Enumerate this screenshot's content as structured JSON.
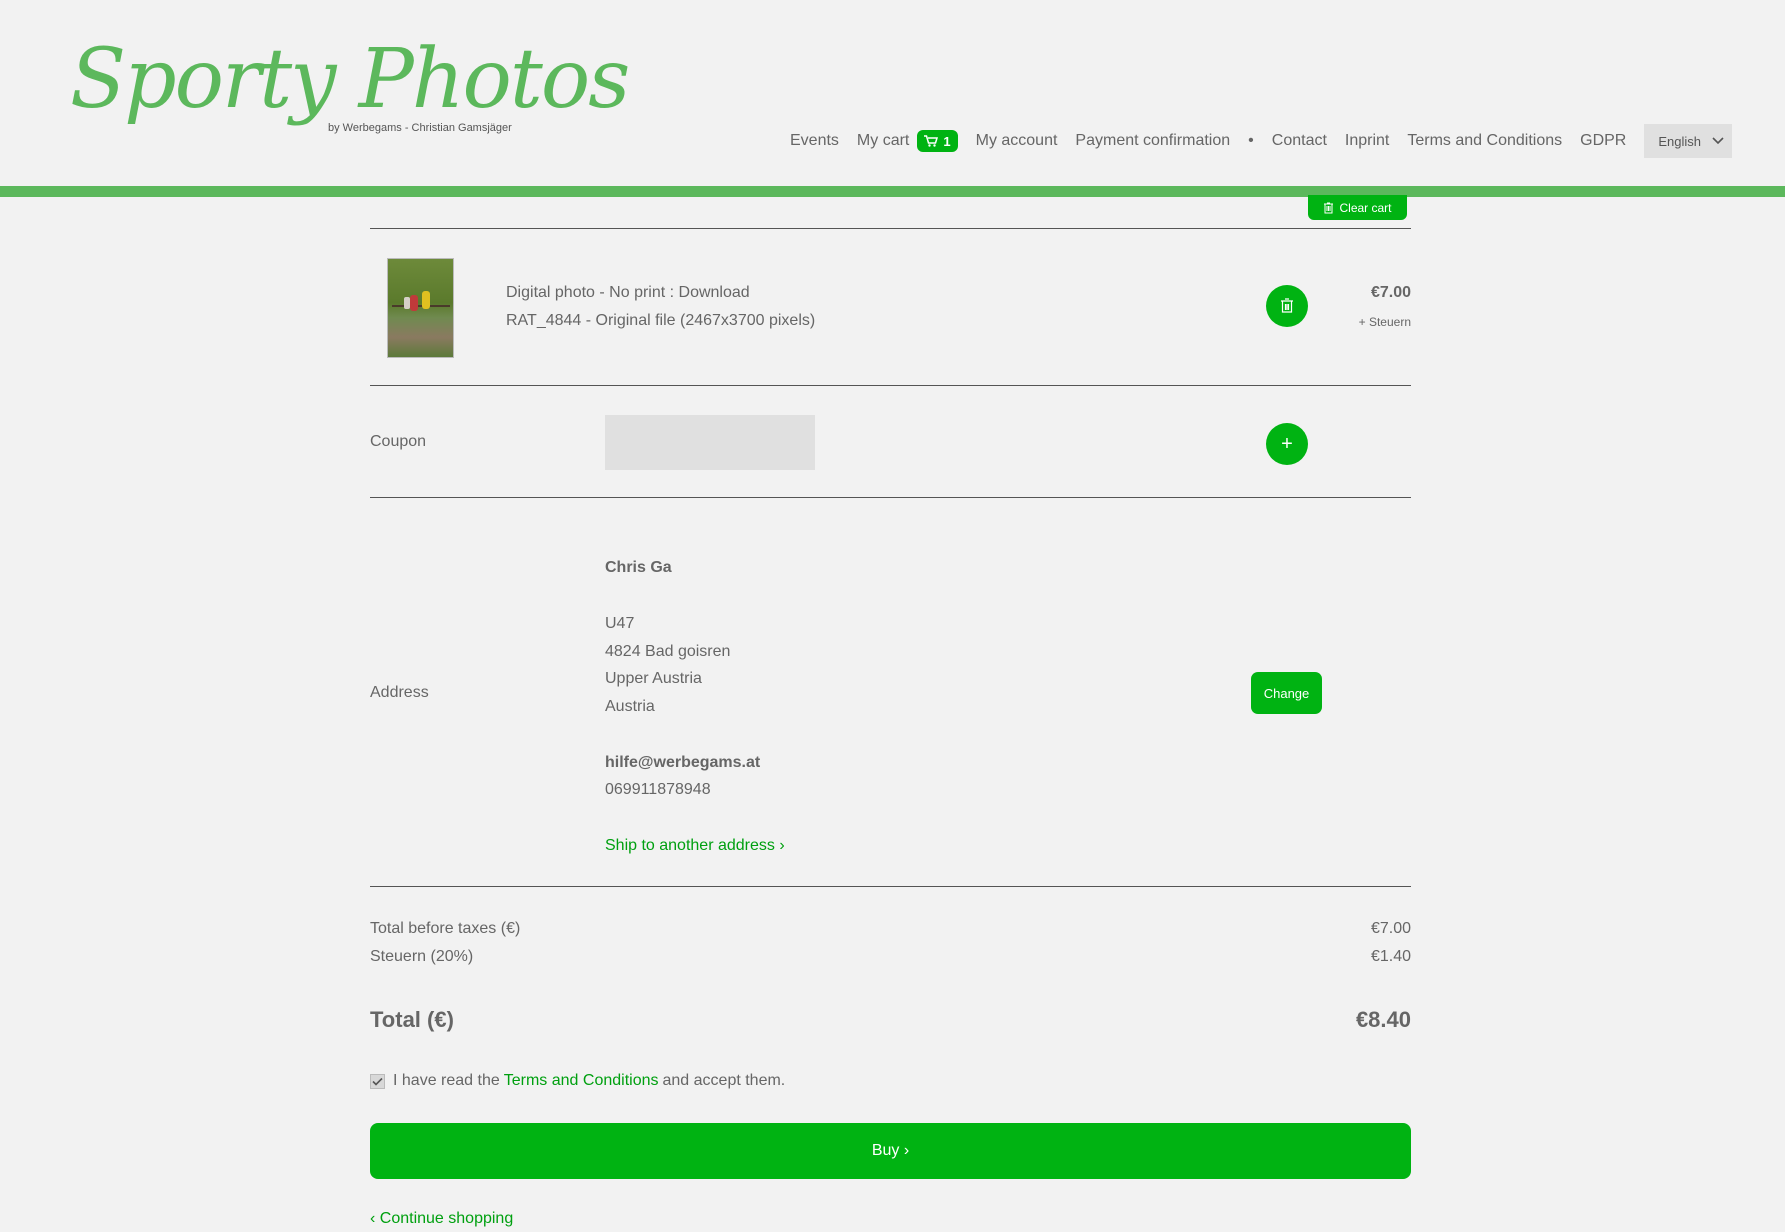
{
  "brand": {
    "logo_text": "Sporty Photos",
    "logo_sub": "by Werbegams - Christian Gamsjäger",
    "accent": "#00b312",
    "bar_color": "#5cb85c"
  },
  "nav": {
    "events": "Events",
    "my_cart": "My cart",
    "cart_count": "1",
    "my_account": "My account",
    "payment_confirmation": "Payment confirmation",
    "separator": "•",
    "contact": "Contact",
    "inprint": "Inprint",
    "terms": "Terms and Conditions",
    "gdpr": "GDPR",
    "language": "English"
  },
  "cart": {
    "clear_label": "Clear cart",
    "item": {
      "line1": "Digital photo - No print : Download",
      "line2": "RAT_4844 - Original file (2467x3700 pixels)",
      "price": "€7.00",
      "tax_note": "+ Steuern"
    },
    "coupon_label": "Coupon",
    "coupon_add": "+",
    "address_label": "Address",
    "address": {
      "name": "Chris Ga",
      "line1": "U47",
      "line2": "4824 Bad goisren",
      "line3": "Upper Austria",
      "line4": "Austria",
      "email": "hilfe@werbegams.at",
      "phone": "069911878948",
      "change": "Change",
      "ship_other": "Ship to another address  ›"
    },
    "summary": {
      "before_tax_label": "Total before taxes (€)",
      "before_tax_value": "€7.00",
      "tax_label": "Steuern (20%)",
      "tax_value": "€1.40",
      "total_label": "Total (€)",
      "total_value": "€8.40"
    },
    "terms": {
      "pre": "I have read the",
      "link": "Terms and Conditions",
      "post": "and accept them.",
      "checked": true
    },
    "buy": "Buy  ›",
    "continue": "‹  Continue shopping"
  }
}
